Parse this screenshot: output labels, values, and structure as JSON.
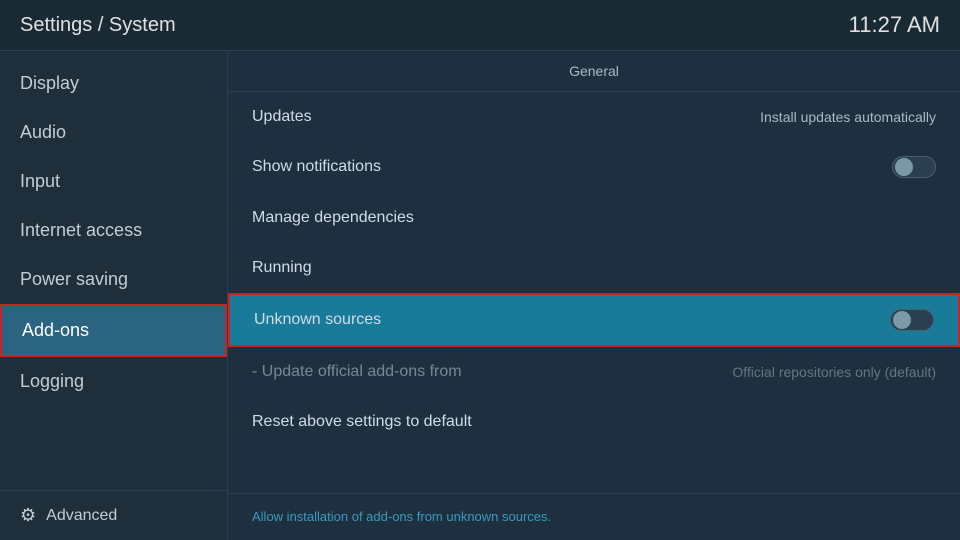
{
  "header": {
    "title": "Settings / System",
    "time": "11:27 AM"
  },
  "sidebar": {
    "items": [
      {
        "id": "display",
        "label": "Display",
        "active": false
      },
      {
        "id": "audio",
        "label": "Audio",
        "active": false
      },
      {
        "id": "input",
        "label": "Input",
        "active": false
      },
      {
        "id": "internet-access",
        "label": "Internet access",
        "active": false
      },
      {
        "id": "power-saving",
        "label": "Power saving",
        "active": false
      },
      {
        "id": "add-ons",
        "label": "Add-ons",
        "active": true
      },
      {
        "id": "logging",
        "label": "Logging",
        "active": false
      }
    ],
    "footer": {
      "label": "Advanced",
      "icon": "gear"
    }
  },
  "content": {
    "section_label": "General",
    "rows": [
      {
        "id": "updates",
        "label": "Updates",
        "value": "Install updates automatically",
        "type": "value",
        "highlighted": false,
        "dimmed": false
      },
      {
        "id": "show-notifications",
        "label": "Show notifications",
        "value": "",
        "type": "toggle",
        "toggle_on": false,
        "highlighted": false,
        "dimmed": false
      },
      {
        "id": "manage-dependencies",
        "label": "Manage dependencies",
        "value": "",
        "type": "none",
        "highlighted": false,
        "dimmed": false
      },
      {
        "id": "running",
        "label": "Running",
        "value": "",
        "type": "none",
        "highlighted": false,
        "dimmed": false
      },
      {
        "id": "unknown-sources",
        "label": "Unknown sources",
        "value": "",
        "type": "toggle",
        "toggle_on": false,
        "highlighted": true,
        "dimmed": false
      },
      {
        "id": "update-official",
        "label": "- Update official add-ons from",
        "value": "Official repositories only (default)",
        "type": "value",
        "highlighted": false,
        "dimmed": true
      },
      {
        "id": "reset-settings",
        "label": "Reset above settings to default",
        "value": "",
        "type": "none",
        "highlighted": false,
        "dimmed": false
      }
    ],
    "footer_hint": "Allow installation of add-ons from unknown sources."
  }
}
